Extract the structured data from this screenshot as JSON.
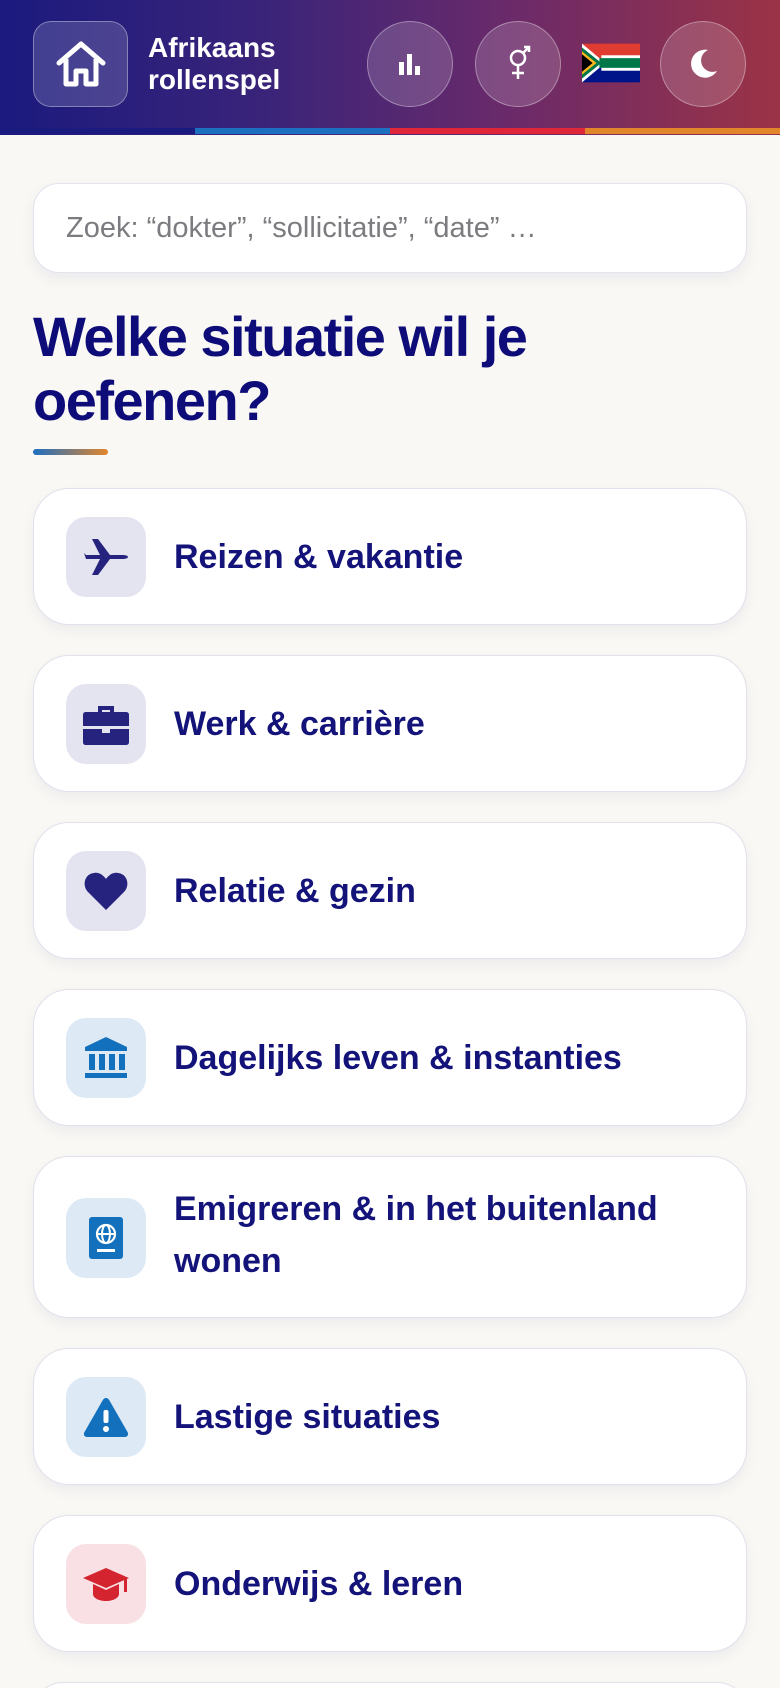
{
  "header": {
    "title_line1": "Afrikaans",
    "title_line2": "rollenspel",
    "home_icon": "home-icon",
    "stats_icon": "bar-chart-icon",
    "gender_icon": "gender-icon",
    "flag_icon": "south-africa-flag-icon",
    "theme_icon": "moon-icon",
    "stripe_colors": [
      "#1b1a7e",
      "#1d6fc0",
      "#e0273a",
      "#e2862c"
    ]
  },
  "search": {
    "placeholder": "Zoek: “dokter”, “sollicitatie”, “date” …",
    "value": ""
  },
  "main": {
    "heading": "Welke situatie wil je oefenen?",
    "categories": [
      {
        "label": "Reizen & vakantie",
        "icon": "airplane-icon",
        "icon_color": "#26237f",
        "icon_bg": "#e4e3f0"
      },
      {
        "label": "Werk & carrière",
        "icon": "briefcase-icon",
        "icon_color": "#26237f",
        "icon_bg": "#e4e3f0"
      },
      {
        "label": "Relatie & gezin",
        "icon": "heart-icon",
        "icon_color": "#26237f",
        "icon_bg": "#e4e3f0"
      },
      {
        "label": "Dagelijks leven & instanties",
        "icon": "bank-icon",
        "icon_color": "#1270bd",
        "icon_bg": "#dde9f4"
      },
      {
        "label": "Emigreren & in het buitenland wonen",
        "icon": "passport-icon",
        "icon_color": "#1270bd",
        "icon_bg": "#dde9f4"
      },
      {
        "label": "Lastige situaties",
        "icon": "warning-icon",
        "icon_color": "#1270bd",
        "icon_bg": "#dde9f4"
      },
      {
        "label": "Onderwijs & leren",
        "icon": "graduation-cap-icon",
        "icon_color": "#d3242f",
        "icon_bg": "#f8e0e4"
      }
    ]
  }
}
